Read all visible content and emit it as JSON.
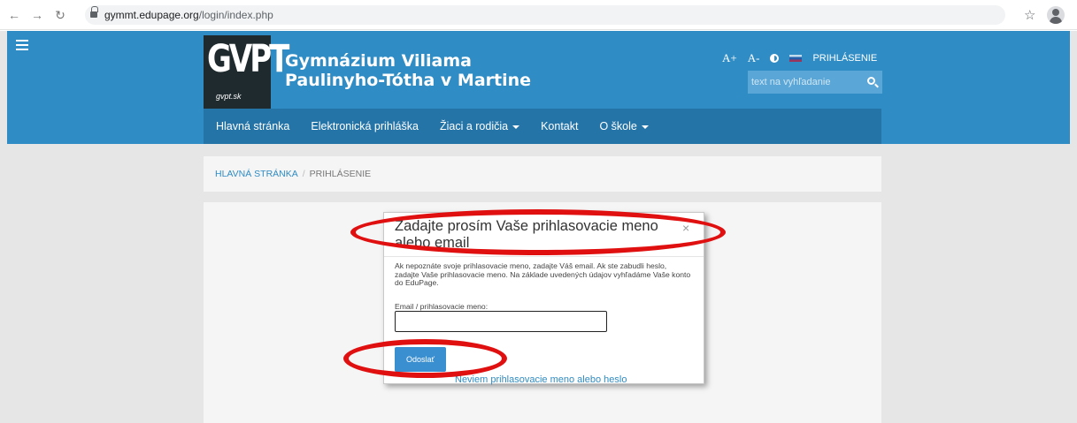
{
  "browser": {
    "url_host": "gymmt.edupage.org",
    "url_path": "/login/index.php",
    "back_icon": "arrow-left-icon",
    "forward_icon": "arrow-right-icon",
    "reload_icon": "reload-icon",
    "star_icon": "star-icon",
    "profile_icon": "profile-icon"
  },
  "header": {
    "logo_letters": "GVPT",
    "logo_small": "gvpt.sk",
    "school_title": "Gymnázium Viliama Paulinyho-Tótha v Martine",
    "font_increase": "A+",
    "font_decrease": "A-",
    "login_link": "PRIHLÁSENIE",
    "search_placeholder": "text na vyhľadanie"
  },
  "menu": {
    "items": [
      {
        "label": "Hlavná stránka"
      },
      {
        "label": "Elektronická prihláška"
      },
      {
        "label": "Žiaci a rodičia"
      },
      {
        "label": "Kontakt"
      },
      {
        "label": "O škole"
      }
    ]
  },
  "breadcrumb": {
    "home": "HLAVNÁ STRÁNKA",
    "separator": "/",
    "current": "PRIHLÁSENIE"
  },
  "dialog": {
    "title": "Zadajte prosím Vaše prihlasovacie meno alebo email",
    "close": "×",
    "text": "Ak nepoznáte svoje prihlasovacie meno, zadajte Váš email. Ak ste zabudli heslo, zadajte Vaše prihlasovacie meno. Na základe uvedených údajov vyhľadáme Vaše konto do EduPage.",
    "field_label": "Email / prihlasovacie meno:",
    "field_value": "",
    "submit": "Odoslať"
  },
  "forgot_link": "Neviem prihlasovacie meno alebo heslo",
  "colors": {
    "header_blue": "#2f8cc4",
    "menu_blue": "#2474a8",
    "annotation_red": "#e01010"
  }
}
